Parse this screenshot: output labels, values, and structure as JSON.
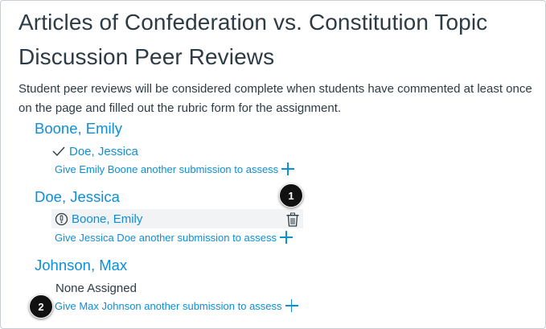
{
  "page": {
    "title": "Articles of Confederation vs. Constitution Topic Discussion Peer Reviews",
    "description": "Student peer reviews will be considered complete when students have commented at least once on the page and filled out the rubric form for the assignment."
  },
  "assessors": [
    {
      "name": "Boone, Emily",
      "assignments": [
        {
          "name": "Doe, Jessica",
          "status": "completed",
          "icon": "checkmark-icon"
        }
      ],
      "give_link": "Give Emily Boone another submission to assess"
    },
    {
      "name": "Doe, Jessica",
      "assignments": [
        {
          "name": "Boone, Emily",
          "status": "incomplete",
          "icon": "warning-circle-icon"
        }
      ],
      "give_link": "Give Jessica Doe another submission to assess"
    },
    {
      "name": "Johnson, Max",
      "none_text": "None Assigned",
      "give_link": "Give Max Johnson another submission to assess"
    }
  ],
  "callouts": [
    "1",
    "2"
  ],
  "colors": {
    "link": "#0e8ed6",
    "text": "#2d3b45",
    "highlight_row": "#f2f3f4",
    "callout": "#111111"
  }
}
